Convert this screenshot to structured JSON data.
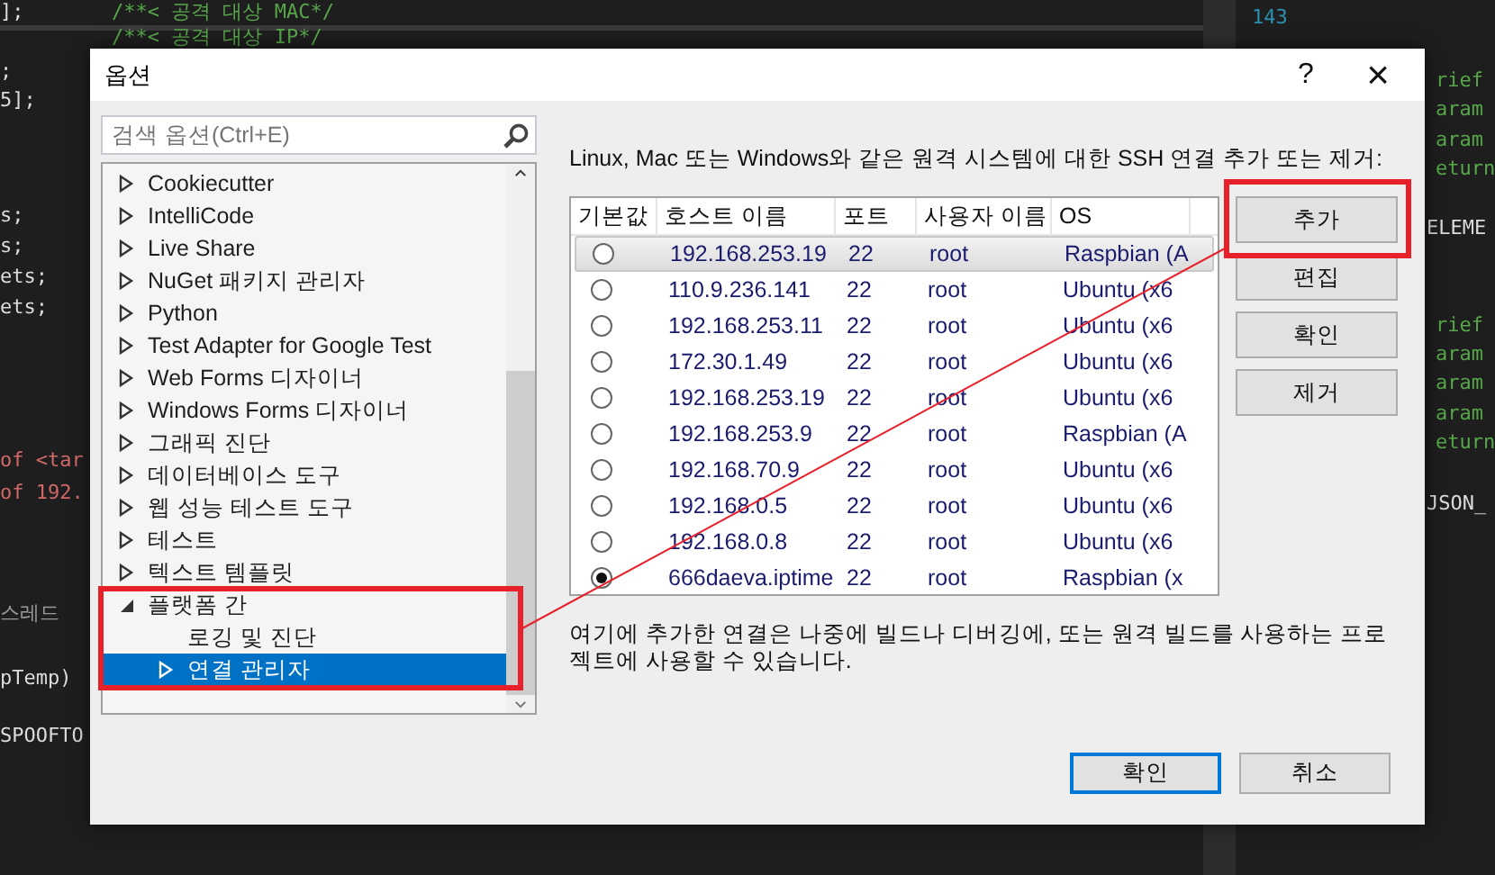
{
  "editor_lines": [
    {
      "text": "];",
      "kind": "code"
    },
    {
      "text": "/**< 공격 대상 MAC*/",
      "kind": "comment"
    },
    {
      "text": "/**< 공격 대상 IP*/",
      "kind": "comment"
    },
    {
      "text": ";",
      "kind": "code"
    },
    {
      "text": "5];",
      "kind": "code"
    },
    {
      "text": "s;",
      "kind": "code"
    },
    {
      "text": "s;",
      "kind": "code"
    },
    {
      "text": "ets;",
      "kind": "code"
    },
    {
      "text": "ets;",
      "kind": "code"
    },
    {
      "text": "of <tar",
      "kind": "string"
    },
    {
      "text": "of 192.",
      "kind": "string"
    },
    {
      "text": "스레드",
      "kind": "muted"
    },
    {
      "text": "pTemp)",
      "kind": "code"
    },
    {
      "text": "SPOOFTO",
      "kind": "code"
    },
    {
      "text": "143",
      "kind": "line_number"
    },
    {
      "text": "rief",
      "kind": "comment"
    },
    {
      "text": "aram",
      "kind": "comment"
    },
    {
      "text": "aram",
      "kind": "comment"
    },
    {
      "text": "eturn",
      "kind": "comment"
    },
    {
      "text": "ELEME",
      "kind": "code"
    },
    {
      "text": "rief",
      "kind": "comment"
    },
    {
      "text": "aram",
      "kind": "comment"
    },
    {
      "text": "aram",
      "kind": "comment"
    },
    {
      "text": "aram",
      "kind": "comment"
    },
    {
      "text": "eturn",
      "kind": "comment"
    },
    {
      "text": "JSON_",
      "kind": "code"
    }
  ],
  "window": {
    "title": "옵션",
    "help": "?",
    "close": "×"
  },
  "search": {
    "placeholder": "검색 옵션(Ctrl+E)"
  },
  "tree": [
    {
      "label": "Cookiecutter",
      "kind": "folder",
      "expanded": false,
      "selected": false
    },
    {
      "label": "IntelliCode",
      "kind": "folder",
      "expanded": false,
      "selected": false
    },
    {
      "label": "Live Share",
      "kind": "folder",
      "expanded": false,
      "selected": false
    },
    {
      "label": "NuGet 패키지 관리자",
      "kind": "folder",
      "expanded": false,
      "selected": false
    },
    {
      "label": "Python",
      "kind": "folder",
      "expanded": false,
      "selected": false
    },
    {
      "label": "Test Adapter for Google Test",
      "kind": "folder",
      "expanded": false,
      "selected": false
    },
    {
      "label": "Web Forms 디자이너",
      "kind": "folder",
      "expanded": false,
      "selected": false
    },
    {
      "label": "Windows Forms 디자이너",
      "kind": "folder",
      "expanded": false,
      "selected": false
    },
    {
      "label": "그래픽 진단",
      "kind": "folder",
      "expanded": false,
      "selected": false
    },
    {
      "label": "데이터베이스 도구",
      "kind": "folder",
      "expanded": false,
      "selected": false
    },
    {
      "label": "웹 성능 테스트 도구",
      "kind": "folder",
      "expanded": false,
      "selected": false
    },
    {
      "label": "테스트",
      "kind": "folder",
      "expanded": false,
      "selected": false
    },
    {
      "label": "텍스트 템플릿",
      "kind": "folder",
      "expanded": false,
      "selected": false
    },
    {
      "label": "플랫폼 간",
      "kind": "folder",
      "expanded": true,
      "selected": false,
      "children": [
        {
          "label": "로깅 및 진단",
          "kind": "leaf",
          "selected": false
        },
        {
          "label": "연결 관리자",
          "kind": "folder",
          "expanded": false,
          "selected": true
        }
      ]
    }
  ],
  "description": "Linux, Mac 또는 Windows와 같은 원격 시스템에 대한 SSH 연결 추가 또는 제거:",
  "table": {
    "columns": [
      "기본값",
      "호스트 이름",
      "포트",
      "사용자 이름",
      "OS"
    ],
    "rows": [
      {
        "default": false,
        "selected": true,
        "host": "192.168.253.19",
        "port": "22",
        "user": "root",
        "os": "Raspbian (A"
      },
      {
        "default": false,
        "selected": false,
        "host": "110.9.236.141",
        "port": "22",
        "user": "root",
        "os": "Ubuntu (x6"
      },
      {
        "default": false,
        "selected": false,
        "host": "192.168.253.11",
        "port": "22",
        "user": "root",
        "os": "Ubuntu (x6"
      },
      {
        "default": false,
        "selected": false,
        "host": "172.30.1.49",
        "port": "22",
        "user": "root",
        "os": "Ubuntu (x6"
      },
      {
        "default": false,
        "selected": false,
        "host": "192.168.253.19",
        "port": "22",
        "user": "root",
        "os": "Ubuntu (x6"
      },
      {
        "default": false,
        "selected": false,
        "host": "192.168.253.9",
        "port": "22",
        "user": "root",
        "os": "Raspbian (A"
      },
      {
        "default": false,
        "selected": false,
        "host": "192.168.70.9",
        "port": "22",
        "user": "root",
        "os": "Ubuntu (x6"
      },
      {
        "default": false,
        "selected": false,
        "host": "192.168.0.5",
        "port": "22",
        "user": "root",
        "os": "Ubuntu (x6"
      },
      {
        "default": false,
        "selected": false,
        "host": "192.168.0.8",
        "port": "22",
        "user": "root",
        "os": "Ubuntu (x6"
      },
      {
        "default": true,
        "selected": false,
        "host": "666daeva.iptime",
        "port": "22",
        "user": "root",
        "os": "Raspbian (x"
      }
    ]
  },
  "side_buttons": [
    "추가",
    "편집",
    "확인",
    "제거"
  ],
  "note": "여기에 추가한 연결은 나중에 빌드나 디버깅에, 또는 원격 빌드를 사용하는 프로젝트에 사용할 수 있습니다.",
  "footer_buttons": [
    {
      "label": "확인",
      "default": true
    },
    {
      "label": "취소",
      "default": false
    }
  ]
}
